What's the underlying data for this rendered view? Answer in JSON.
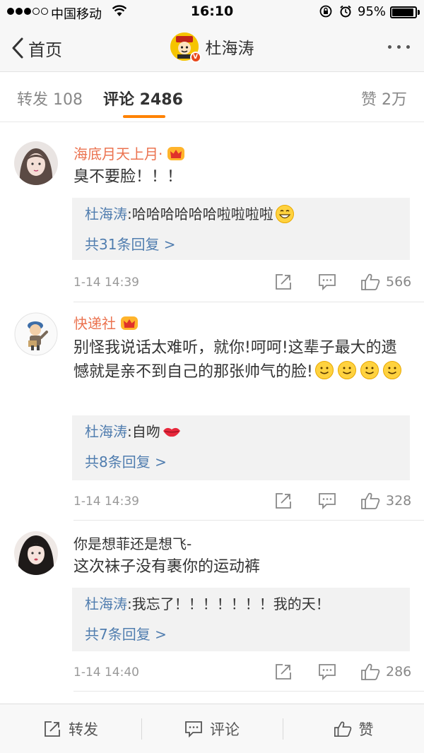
{
  "status_bar": {
    "carrier": "中国移动",
    "time": "16:10",
    "battery_percent": "95%",
    "battery_level": 0.95
  },
  "nav": {
    "back_label": "首页",
    "title": "杜海涛",
    "avatar_badge": "V"
  },
  "tabs": {
    "repost": "转发 108",
    "comment": "评论 2486",
    "like": "赞 2万"
  },
  "comments": [
    {
      "username": "海底月天上月·",
      "vip": true,
      "text": "臭不要脸！！！",
      "reply_user": "杜海涛",
      "reply_text": "哈哈哈哈哈哈啦啦啦啦",
      "reply_more": "共31条回复 >",
      "time": "1-14 14:39",
      "likes": "566"
    },
    {
      "username": "快递社",
      "vip": true,
      "text": "别怪我说话太难听，就你!呵呵!这辈子最大的遗憾就是亲不到自己的那张帅气的脸!",
      "reply_user": "杜海涛",
      "reply_text": "自吻",
      "reply_more": "共8条回复 >",
      "time": "1-14 14:39",
      "likes": "328"
    },
    {
      "username": "你是想菲还是想飞-",
      "vip": false,
      "text": "这次袜子没有裹你的运动裤",
      "reply_user": "杜海涛",
      "reply_text": "我忘了！！！！！！！我的天！",
      "reply_more": "共7条回复 >",
      "time": "1-14 14:40",
      "likes": "286"
    }
  ],
  "reply_separator": ": ",
  "toolbar": {
    "repost": "转发",
    "comment": "评论",
    "like": "赞"
  },
  "colors": {
    "accent": "#ff8200",
    "vip_name": "#eb7350",
    "link": "#507daf"
  }
}
